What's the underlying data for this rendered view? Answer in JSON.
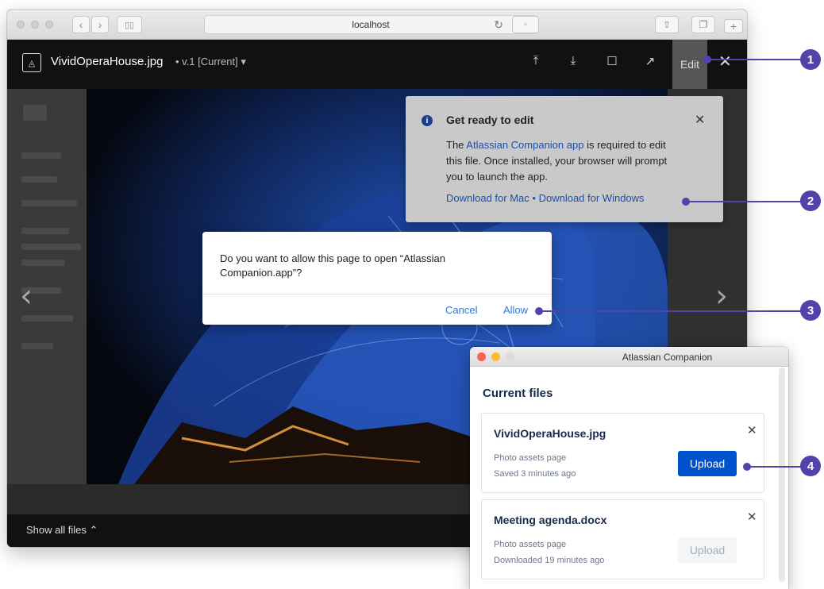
{
  "browser": {
    "url": "localhost"
  },
  "viewer": {
    "file_name": "VividOperaHouse.jpg",
    "version": "•  v.1 [Current] ▾",
    "edit_label": "Edit",
    "show_all": "Show all files ⌃"
  },
  "toast": {
    "title": "Get ready to edit",
    "body_pre": "The ",
    "body_link": "Atlassian Companion app",
    "body_post": " is required to edit this file. Once installed, your browser will prompt you to launch the app.",
    "download_mac": "Download for Mac",
    "separator": "•",
    "download_win": "Download for Windows"
  },
  "dialog": {
    "message": "Do you want to allow this page to open “Atlassian Companion.app”?",
    "cancel": "Cancel",
    "allow": "Allow"
  },
  "companion": {
    "window_title": "Atlassian Companion",
    "heading": "Current files",
    "files": [
      {
        "name": "VividOperaHouse.jpg",
        "location": "Photo assets page",
        "status": "Saved 3 minutes ago",
        "action": "Upload",
        "action_enabled": true
      },
      {
        "name": "Meeting agenda.docx",
        "location": "Photo assets page",
        "status": "Downloaded 19 minutes ago",
        "action": "Upload",
        "action_enabled": false
      }
    ]
  },
  "callouts": [
    "1",
    "2",
    "3",
    "4"
  ],
  "colors": {
    "callout": "#5243aa",
    "primary_button": "#0052cc",
    "link": "#1d4fa8"
  }
}
